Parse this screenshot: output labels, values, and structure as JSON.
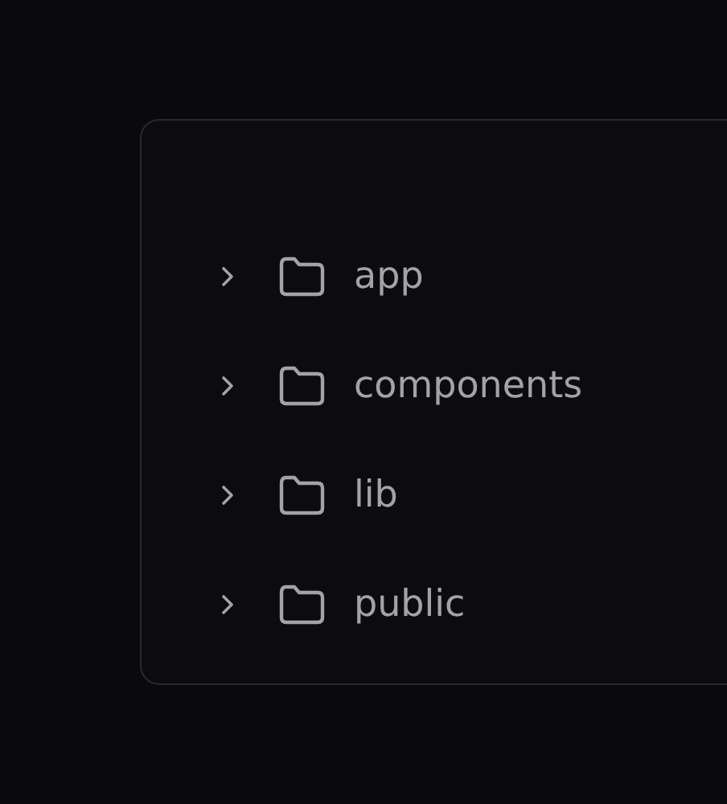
{
  "tree": {
    "items": [
      {
        "name": "app",
        "expanded": false
      },
      {
        "name": "components",
        "expanded": false
      },
      {
        "name": "lib",
        "expanded": false
      },
      {
        "name": "public",
        "expanded": false
      }
    ]
  }
}
